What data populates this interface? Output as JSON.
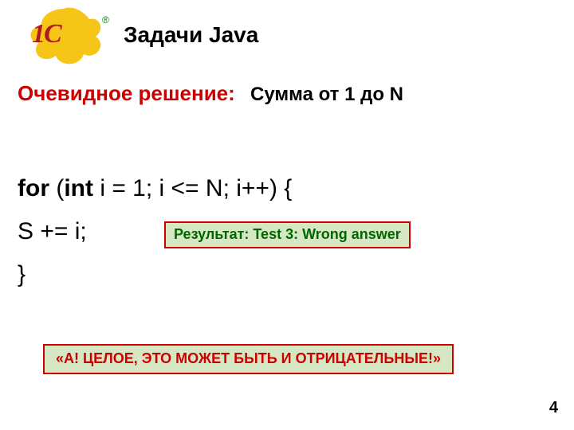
{
  "logo": {
    "mark": "1C",
    "reg": "®"
  },
  "title": "Задачи Java",
  "subtitle": {
    "red": "Очевидное решение:",
    "black": "Сумма от 1 до N"
  },
  "code": {
    "line1_kw1": "for",
    "line1_mid1": " (",
    "line1_kw2": "int",
    "line1_rest": " i = 1; i <= N; i++) {",
    "line2": "S += i;",
    "line3": "}"
  },
  "result_box": "Результат: Test 3: Wrong answer",
  "insight_box": "«А! ЦЕЛОЕ, ЭТО МОЖЕТ БЫТЬ И ОТРИЦАТЕЛЬНЫЕ!»",
  "page_number": "4"
}
